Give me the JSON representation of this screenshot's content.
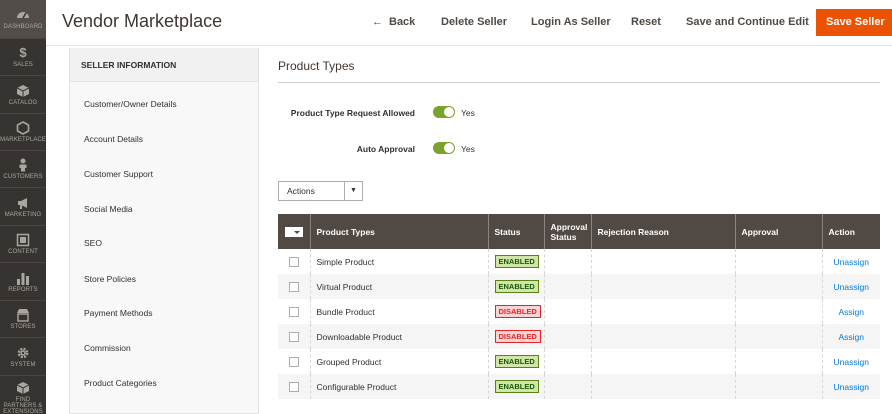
{
  "nav": [
    {
      "label": "DASHBOARD",
      "icon": "dashboard-icon"
    },
    {
      "label": "SALES",
      "icon": "dollar-icon"
    },
    {
      "label": "CATALOG",
      "icon": "cube-icon"
    },
    {
      "label": "MARKETPLACE",
      "icon": "hexagon-icon"
    },
    {
      "label": "CUSTOMERS",
      "icon": "person-icon"
    },
    {
      "label": "MARKETING",
      "icon": "megaphone-icon"
    },
    {
      "label": "CONTENT",
      "icon": "layout-icon"
    },
    {
      "label": "REPORTS",
      "icon": "bar-chart-icon"
    },
    {
      "label": "STORES",
      "icon": "store-icon"
    },
    {
      "label": "SYSTEM",
      "icon": "gear-icon"
    },
    {
      "label": "FIND PARTNERS & EXTENSIONS",
      "icon": "partners-cube-icon"
    }
  ],
  "header": {
    "title": "Vendor Marketplace",
    "back": "Back",
    "delete_seller": "Delete Seller",
    "login_as_seller": "Login As Seller",
    "reset": "Reset",
    "save_continue": "Save and Continue Edit",
    "save_seller": "Save Seller"
  },
  "tabs": {
    "heading": "SELLER INFORMATION",
    "items": [
      "Customer/Owner Details",
      "Account Details",
      "Customer Support",
      "Social Media",
      "SEO",
      "Store Policies",
      "Payment Methods",
      "Commission",
      "Product Categories"
    ]
  },
  "main": {
    "section_title": "Product Types",
    "fields": [
      {
        "label": "Product Type Request Allowed",
        "value": "Yes",
        "enabled": true
      },
      {
        "label": "Auto Approval",
        "value": "Yes",
        "enabled": true
      }
    ],
    "actions_label": "Actions"
  },
  "grid": {
    "columns": [
      "Product Types",
      "Status",
      "Approval Status",
      "Rejection Reason",
      "Approval",
      "Action"
    ],
    "rows": [
      {
        "type": "Simple Product",
        "status": "ENABLED",
        "action": "Unassign"
      },
      {
        "type": "Virtual Product",
        "status": "ENABLED",
        "action": "Unassign"
      },
      {
        "type": "Bundle Product",
        "status": "DISABLED",
        "action": "Assign"
      },
      {
        "type": "Downloadable Product",
        "status": "DISABLED",
        "action": "Assign"
      },
      {
        "type": "Grouped Product",
        "status": "ENABLED",
        "action": "Unassign"
      },
      {
        "type": "Configurable Product",
        "status": "ENABLED",
        "action": "Unassign"
      }
    ]
  },
  "colors": {
    "nav_bg": "#373330",
    "primary_button": "#eb5202",
    "grid_header": "#514943",
    "toggle_on": "#79a22e",
    "link": "#007bdb"
  }
}
